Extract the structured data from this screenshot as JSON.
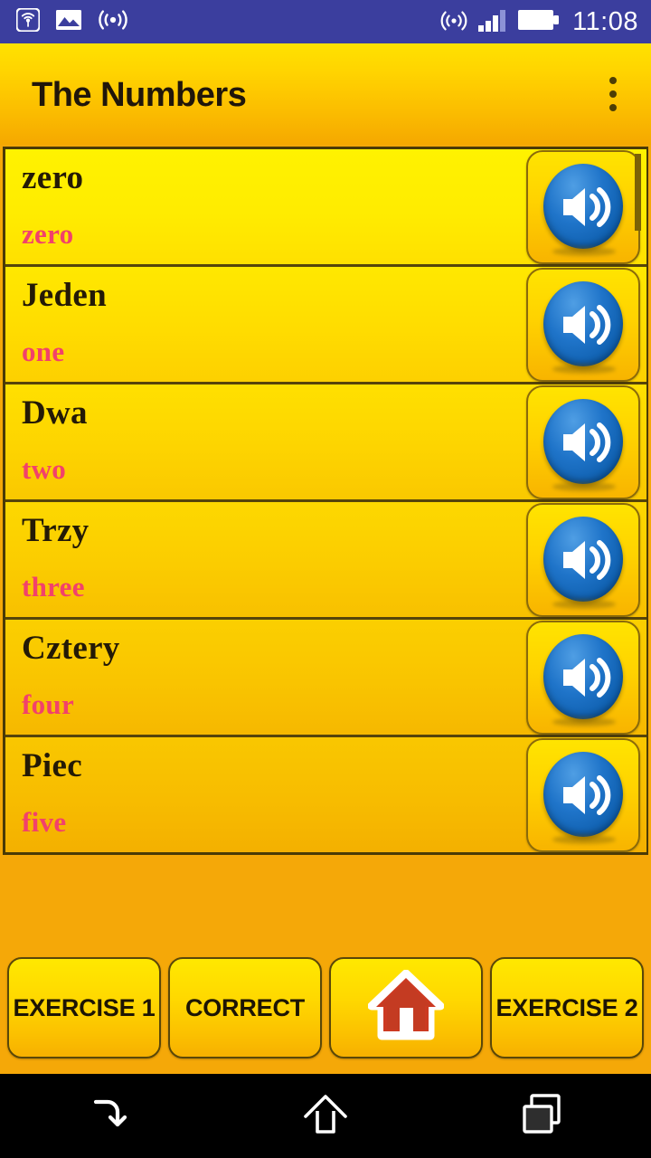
{
  "status_bar": {
    "background_color": "#3b3e9e",
    "left_icons": [
      "broadcast-badge-icon",
      "image-icon",
      "wifi-waves-icon"
    ],
    "right_icons": [
      "cast-icon",
      "signal-bars-icon",
      "battery-full-icon"
    ],
    "clock": "11:08"
  },
  "app_bar": {
    "title": "The Numbers",
    "overflow_label": "More options",
    "gradient_top": "#ffe200",
    "gradient_bottom": "#f5a800"
  },
  "word_list": {
    "scrollbar_visible": true,
    "rows": [
      {
        "term": "zero",
        "translation": "zero",
        "speaker_icon": "speaker-icon"
      },
      {
        "term": "Jeden",
        "translation": "one",
        "speaker_icon": "speaker-icon"
      },
      {
        "term": "Dwa",
        "translation": "two",
        "speaker_icon": "speaker-icon"
      },
      {
        "term": "Trzy",
        "translation": "three",
        "speaker_icon": "speaker-icon"
      },
      {
        "term": "Cztery",
        "translation": "four",
        "speaker_icon": "speaker-icon"
      },
      {
        "term": "Piec",
        "translation": "five",
        "speaker_icon": "speaker-icon"
      }
    ],
    "term_color": "#241a06",
    "translation_color": "#f2416b"
  },
  "bottom_buttons": [
    {
      "label": "EXERCISE 1",
      "icon": null
    },
    {
      "label": "CORRECT",
      "icon": null
    },
    {
      "label": "",
      "icon": "home-house-icon"
    },
    {
      "label": "EXERCISE 2",
      "icon": null
    }
  ],
  "nav_bar": {
    "items": [
      {
        "icon": "back-arrow-icon",
        "label": "Back"
      },
      {
        "icon": "home-outline-icon",
        "label": "Home"
      },
      {
        "icon": "recents-squares-icon",
        "label": "Recents"
      }
    ],
    "highlighted": "recents-squares-icon"
  }
}
